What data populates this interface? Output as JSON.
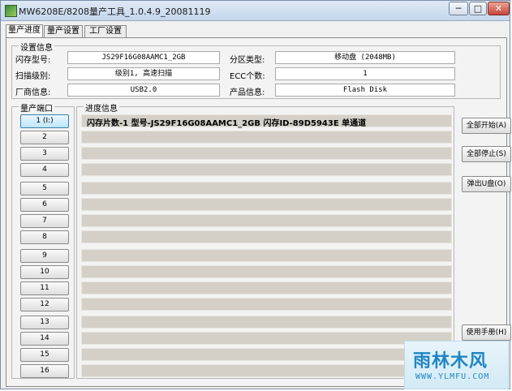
{
  "window": {
    "title": "MW6208E/8208量产工具_1.0.4.9_20081119",
    "min_glyph": "─",
    "max_glyph": "□",
    "close_glyph": "✕"
  },
  "tabs": [
    {
      "label": "量产进度",
      "active": true
    },
    {
      "label": "量产设置",
      "active": false
    },
    {
      "label": "工厂设置",
      "active": false
    }
  ],
  "settings": {
    "title": "设置信息",
    "flash_model_label": "闪存型号:",
    "flash_model_value": "JS29F16G08AAMC1_2GB",
    "partition_type_label": "分区类型:",
    "partition_type_value": "移动盘 (2048MB)",
    "scan_level_label": "扫描级别:",
    "scan_level_value": "级别1, 高速扫描",
    "ecc_count_label": "ECC个数:",
    "ecc_count_value": "1",
    "vendor_info_label": "厂商信息:",
    "vendor_info_value": "USB2.0",
    "product_info_label": "产品信息:",
    "product_info_value": "Flash Disk"
  },
  "ports": {
    "title": "量产端口",
    "items": [
      "1 (I:)",
      "2",
      "3",
      "4",
      "5",
      "6",
      "7",
      "8",
      "9",
      "10",
      "11",
      "12",
      "13",
      "14",
      "15",
      "16"
    ]
  },
  "progress": {
    "title": "进度信息",
    "rows": [
      "闪存片数-1 型号-JS29F16G08AAMC1_2GB 闪存ID-89D5943E 单通道",
      "",
      "",
      "",
      "",
      "",
      "",
      "",
      "",
      "",
      "",
      "",
      "",
      "",
      "",
      ""
    ]
  },
  "side_buttons": {
    "start_all": "全部开始(A)",
    "stop_all": "全部停止(S)",
    "eject_disk": "弹出U盘(O)",
    "manual": "使用手册(H)"
  },
  "watermark": {
    "logo": "雨林木风",
    "url": "WWW.YLMFU.COM"
  },
  "colors": {
    "progress_row": "#d4d0c7",
    "watermark": "#1f86c5"
  }
}
